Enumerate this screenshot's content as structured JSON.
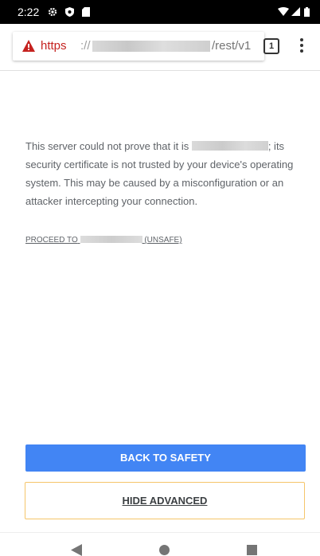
{
  "status_bar": {
    "time": "2:22",
    "icons": [
      "settings-icon",
      "shield-icon",
      "sd-card-icon",
      "wifi-icon",
      "signal-icon",
      "battery-icon"
    ]
  },
  "toolbar": {
    "url_scheme": "https",
    "url_separator": "://",
    "url_path": "/rest/v1",
    "tab_count": "1",
    "warning_icon": "not-secure-warning-icon",
    "menu_icon": "more-vert-icon"
  },
  "content": {
    "message_before": "This server could not prove that it is",
    "message_after": "; its security certificate is not trusted by your device's operating system. This may be caused by a misconfiguration or an attacker intercepting your connection.",
    "proceed_prefix": "PROCEED TO",
    "proceed_suffix": "(UNSAFE)"
  },
  "buttons": {
    "back_to_safety": "BACK TO SAFETY",
    "hide_advanced": "HIDE ADVANCED"
  },
  "nav_bar": {
    "icons": [
      "back-triangle-icon",
      "home-circle-icon",
      "recents-square-icon"
    ]
  },
  "colors": {
    "status_bar": "#000000",
    "url_scheme_red": "#c5221f",
    "primary_button": "#4285f4",
    "secondary_button_border": "#f5c56a",
    "body_text": "#5f6368"
  }
}
